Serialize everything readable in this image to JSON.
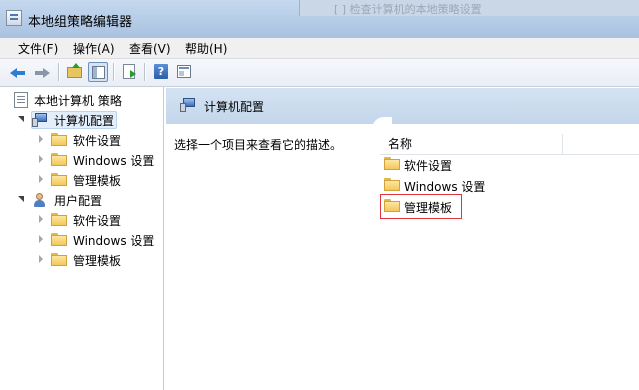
{
  "window": {
    "title": "本地组策略编辑器",
    "background_window_text": "[ ] 检查计算机的本地策略设置"
  },
  "menu": [
    {
      "label": "文件(F)"
    },
    {
      "label": "操作(A)"
    },
    {
      "label": "查看(V)"
    },
    {
      "label": "帮助(H)"
    }
  ],
  "toolbar": {
    "buttons": [
      "back-icon",
      "forward-icon",
      "up-folder-icon",
      "show-hide-tree-icon",
      "export-list-icon",
      "help-icon",
      "properties-icon"
    ],
    "help_glyph": "?"
  },
  "tree": {
    "root": "本地计算机 策略",
    "computer_config": "计算机配置",
    "user_config": "用户配置",
    "computer_children": [
      "软件设置",
      "Windows 设置",
      "管理模板"
    ],
    "user_children": [
      "软件设置",
      "Windows 设置",
      "管理模板"
    ]
  },
  "right_pane": {
    "header_title": "计算机配置",
    "description": "选择一个项目来查看它的描述。",
    "column_name": "名称",
    "items": [
      "软件设置",
      "Windows 设置",
      "管理模板"
    ],
    "highlighted_item": "管理模板",
    "highlight_color": "#e0333a"
  },
  "colors": {
    "header_bg": "#c4d6eb",
    "selection_bg": "#e3eefb"
  }
}
